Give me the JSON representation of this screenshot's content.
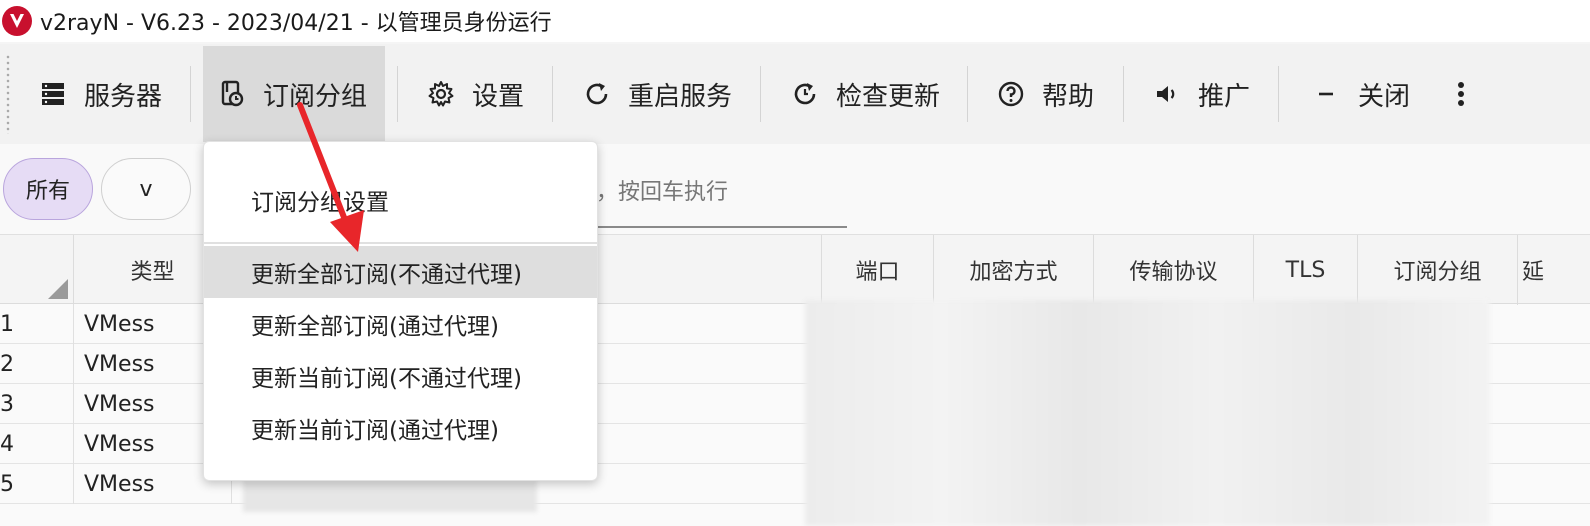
{
  "window": {
    "title": "v2rayN - V6.23 - 2023/04/21 - 以管理员身份运行"
  },
  "toolbar": {
    "servers": "服务器",
    "subscription_group": "订阅分组",
    "settings": "设置",
    "restart_service": "重启服务",
    "check_update": "检查更新",
    "help": "帮助",
    "promote": "推广",
    "close": "关闭"
  },
  "filters": {
    "chips": [
      "所有",
      "v"
    ],
    "search_hint": "，按回车执行"
  },
  "table": {
    "headers": {
      "type": "类型",
      "port": "端口",
      "encryption": "加密方式",
      "transport": "传输协议",
      "tls": "TLS",
      "sub_group": "订阅分组",
      "latency_partial": "延"
    },
    "rows": [
      {
        "index": "1",
        "type": "VMess"
      },
      {
        "index": "2",
        "type": "VMess"
      },
      {
        "index": "3",
        "type": "VMess"
      },
      {
        "index": "4",
        "type": "VMess"
      },
      {
        "index": "5",
        "type": "VMess"
      }
    ]
  },
  "dropdown": {
    "items": [
      "订阅分组设置",
      "更新全部订阅(不通过代理)",
      "更新全部订阅(通过代理)",
      "更新当前订阅(不通过代理)",
      "更新当前订阅(通过代理)"
    ],
    "hovered_index": 1
  },
  "colors": {
    "accent_selected_chip": "#e6dcf5",
    "annotation_arrow": "#e8262a",
    "logo": "#c8102e"
  }
}
